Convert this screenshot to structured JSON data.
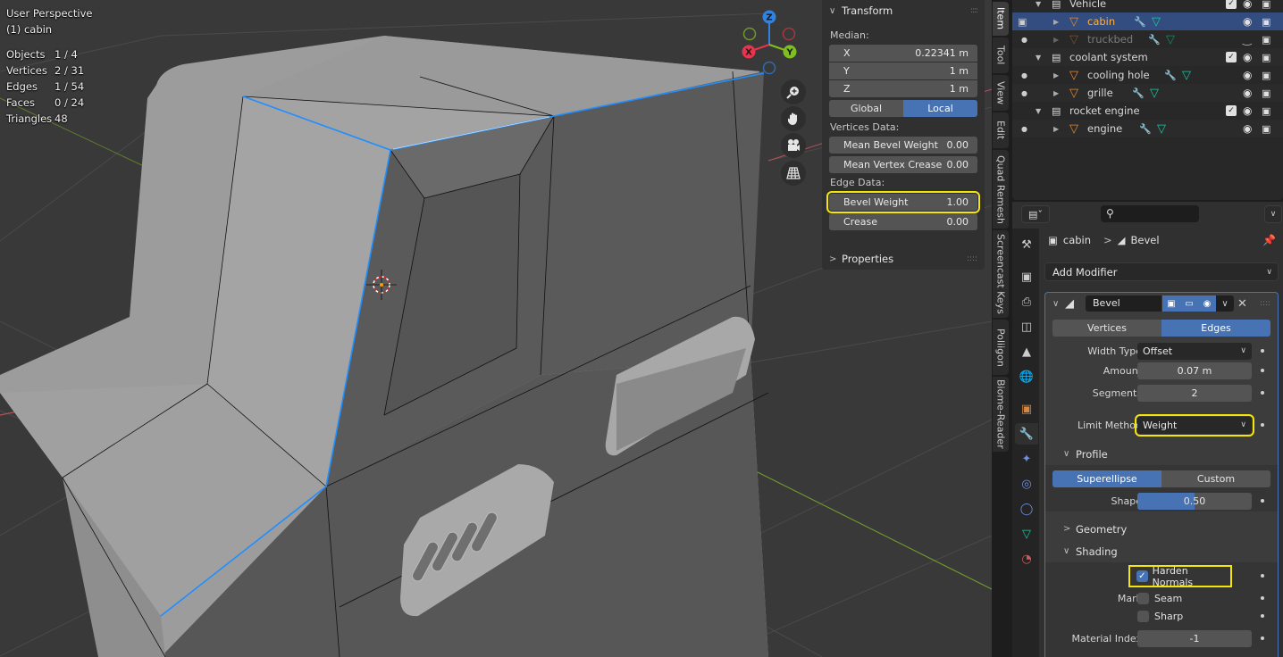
{
  "viewport": {
    "view_name": "User Perspective",
    "active_object": "(1) cabin",
    "stats": [
      {
        "label": "Objects",
        "value": "1 / 4"
      },
      {
        "label": "Vertices",
        "value": "2 / 31"
      },
      {
        "label": "Edges",
        "value": "1 / 54"
      },
      {
        "label": "Faces",
        "value": "0 / 24"
      },
      {
        "label": "Triangles",
        "value": "48"
      }
    ],
    "gizmo": {
      "x": "X",
      "y": "Y",
      "z": "Z",
      "colors": {
        "x": "#e8344c",
        "y": "#7fbf1f",
        "z": "#2f84e3"
      }
    },
    "nav_icons": [
      "zoom-icon",
      "pan-hand-icon",
      "camera-icon",
      "grid-ortho-icon"
    ],
    "colors": {
      "background": "#393939",
      "selected_edge": "#1f8fff",
      "mesh": "#9a9a9a"
    }
  },
  "npanel": {
    "transform_title": "Transform",
    "median_label": "Median:",
    "median": [
      {
        "axis": "X",
        "value": "0.22341 m"
      },
      {
        "axis": "Y",
        "value": "1 m"
      },
      {
        "axis": "Z",
        "value": "1 m"
      }
    ],
    "space_options": [
      "Global",
      "Local"
    ],
    "space_active": "Local",
    "vertices_data_label": "Vertices Data:",
    "vertices_data": [
      {
        "label": "Mean Bevel Weight",
        "value": "0.00"
      },
      {
        "label": "Mean Vertex Crease",
        "value": "0.00"
      }
    ],
    "edge_data_label": "Edge Data:",
    "edge_data": [
      {
        "label": "Bevel Weight",
        "value": "1.00"
      },
      {
        "label": "Crease",
        "value": "0.00"
      }
    ],
    "properties_title": "Properties"
  },
  "sidebar_tabs": [
    "Item",
    "Tool",
    "View",
    "Edit",
    "Quad Remesh",
    "Screencast Keys",
    "Poliigon",
    "Biome-Reader"
  ],
  "sidebar_tab_active": "Item",
  "outliner": {
    "rows": [
      {
        "type": "collection",
        "name": "Vehicle"
      },
      {
        "type": "object",
        "name": "cabin",
        "selected": true
      },
      {
        "type": "object",
        "name": "truckbed",
        "hidden": true
      },
      {
        "type": "collection",
        "name": "coolant system"
      },
      {
        "type": "object",
        "name": "cooling hole"
      },
      {
        "type": "object",
        "name": "grille"
      },
      {
        "type": "collection",
        "name": "rocket engine"
      },
      {
        "type": "object",
        "name": "engine"
      }
    ]
  },
  "properties": {
    "search_placeholder": "",
    "breadcrumb": {
      "object": "cabin",
      "modifier": "Bevel"
    },
    "add_modifier_label": "Add Modifier",
    "modifier": {
      "name": "Bevel",
      "affect_options": [
        "Vertices",
        "Edges"
      ],
      "affect_active": "Edges",
      "width_type_label": "Width Type",
      "width_type": "Offset",
      "amount_label": "Amount",
      "amount": "0.07 m",
      "segments_label": "Segments",
      "segments": "2",
      "limit_method_label": "Limit Method",
      "limit_method": "Weight",
      "profile_label": "Profile",
      "profile_options": [
        "Superellipse",
        "Custom"
      ],
      "profile_active": "Superellipse",
      "shape_label": "Shape",
      "shape": "0.50",
      "shape_fraction": 0.5,
      "geometry_label": "Geometry",
      "shading_label": "Shading",
      "harden_normals_label": "Harden Normals",
      "harden_normals": true,
      "mark_label": "Mark",
      "seam_label": "Seam",
      "seam": false,
      "sharp_label": "Sharp",
      "sharp": false,
      "material_index_label": "Material Index",
      "material_index": "-1"
    },
    "tabs": [
      "tool",
      "render",
      "output",
      "view-layer",
      "scene",
      "world",
      "object",
      "modifiers",
      "particles",
      "physics",
      "constraints",
      "data",
      "material"
    ],
    "tab_active": "modifiers"
  },
  "highlight_color": "#f5e60a",
  "accent_color": "#4772b3"
}
